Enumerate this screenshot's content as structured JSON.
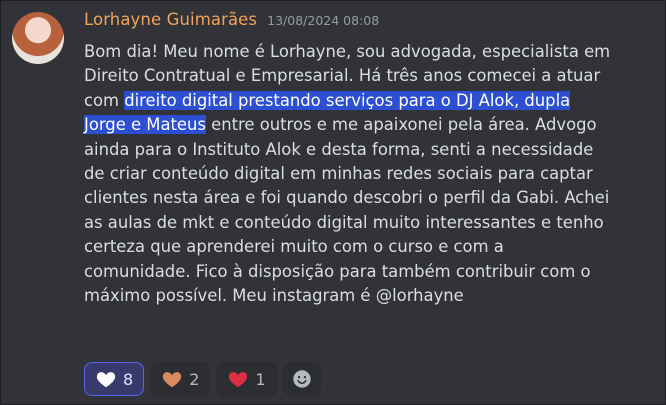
{
  "message": {
    "author": "Lorhayne Guimarães",
    "timestamp": "13/08/2024 08:08",
    "lines": [
      "Bom dia! Meu nome é Lorhayne, sou advogada, especialista em",
      "Direito Contratual e Empresarial. Há três anos comecei a atuar",
      "",
      "",
      "ainda para o Instituto Alok e desta forma, senti a necessidade",
      "de criar conteúdo digital em minhas redes sociais para captar",
      "clientes nesta área e foi quando descobri o perfil da Gabi. Achei",
      "as aulas de mkt e conteúdo digital muito interessantes e tenho",
      "certeza que aprenderei muito com o curso e com a",
      "comunidade. Fico à disposição para também contribuir com o",
      "máximo possível. Meu instagram é @lorhayne"
    ],
    "line3_pre": "com ",
    "line3_sel": "direito digital prestando serviços para o DJ Alok, dupla",
    "line4_sel": "Jorge e Mateus",
    "line4_post": " entre outros e me apaixonei pela área. Advogo"
  },
  "reactions": [
    {
      "emoji": "white-heart",
      "count": "8",
      "color": "#ffffff",
      "active": true
    },
    {
      "emoji": "orange-heart",
      "count": "2",
      "color": "#d98a5f",
      "active": false
    },
    {
      "emoji": "red-heart",
      "count": "1",
      "color": "#dd2e44",
      "active": false
    }
  ],
  "add_reaction": {
    "icon": "smiley-add-icon"
  }
}
